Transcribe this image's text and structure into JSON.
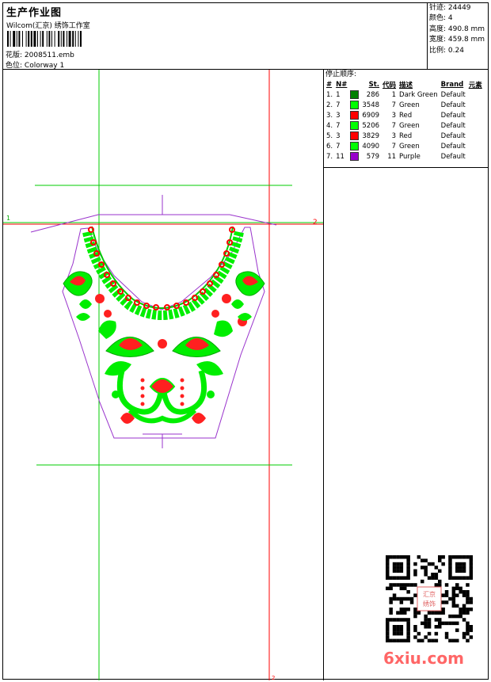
{
  "header": {
    "title": "生产作业图",
    "subtitle": "Wilcom(汇京) 绣饰工作室",
    "design_label": "花版: ",
    "design_value": "2008511.emb",
    "colorway_label": "色位: ",
    "colorway_value": "Colorway 1"
  },
  "stats": [
    {
      "label": "针迹: ",
      "value": "24449"
    },
    {
      "label": "颜色: ",
      "value": "4"
    },
    {
      "label": "高度: ",
      "value": "490.8 mm"
    },
    {
      "label": "宽度: ",
      "value": "459.8 mm"
    },
    {
      "label": "比例: ",
      "value": "0.24"
    }
  ],
  "sequence": {
    "title": "停止顺序:",
    "headers": [
      "#",
      "N#",
      "",
      "St.",
      "代码",
      "描述",
      "Brand",
      "元素"
    ],
    "rows": [
      {
        "idx": "1.",
        "n": "1",
        "color": "#008000",
        "st": "286",
        "code": "1",
        "desc": "Dark Green",
        "brand": "Default"
      },
      {
        "idx": "2.",
        "n": "7",
        "color": "#00ff00",
        "st": "3548",
        "code": "7",
        "desc": "Green",
        "brand": "Default"
      },
      {
        "idx": "3.",
        "n": "3",
        "color": "#ff0000",
        "st": "6909",
        "code": "3",
        "desc": "Red",
        "brand": "Default"
      },
      {
        "idx": "4.",
        "n": "7",
        "color": "#00ff00",
        "st": "5206",
        "code": "7",
        "desc": "Green",
        "brand": "Default"
      },
      {
        "idx": "5.",
        "n": "3",
        "color": "#ff0000",
        "st": "3829",
        "code": "3",
        "desc": "Red",
        "brand": "Default"
      },
      {
        "idx": "6.",
        "n": "7",
        "color": "#00ff00",
        "st": "4090",
        "code": "7",
        "desc": "Green",
        "brand": "Default"
      },
      {
        "idx": "7.",
        "n": "11",
        "color": "#9900cc",
        "st": "579",
        "code": "11",
        "desc": "Purple",
        "brand": "Default"
      }
    ]
  },
  "canvas": {
    "marker_1": "1",
    "marker_2": "2",
    "marker_bottom": "2",
    "guide_green": "#00cc00",
    "guide_red": "#ff0000",
    "outline_purple": "#9933cc"
  },
  "watermark": {
    "text": "6xiu.com",
    "color": "#ff6666",
    "seal_text": "汇京绣饰"
  }
}
